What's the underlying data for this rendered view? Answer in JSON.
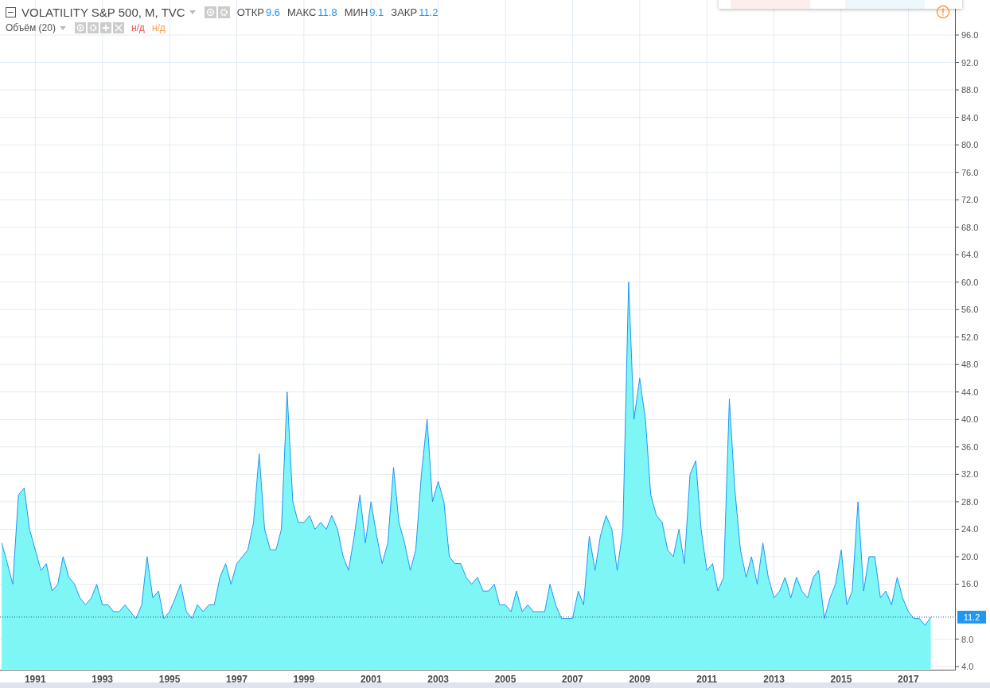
{
  "legend": {
    "title": "VOLATILITY S&P 500, M, TVC",
    "stats": [
      {
        "label": "ОТКР",
        "value": "9.6"
      },
      {
        "label": "МАКС",
        "value": "11.8"
      },
      {
        "label": "МИН",
        "value": "9.1"
      },
      {
        "label": "ЗАКР",
        "value": "11.2"
      }
    ]
  },
  "volume": {
    "title": "Объём (20)",
    "values": [
      {
        "text": "н/д",
        "color": "#f0504f"
      },
      {
        "text": "н/д",
        "color": "#ff9a3c"
      }
    ]
  },
  "chart": {
    "chart_data": {
      "type": "area",
      "grid": true,
      "ref_lines": [
        {
          "axis": "y",
          "value": 11.2,
          "label": "11.2"
        }
      ],
      "series": [
        {
          "color": "#2196f3",
          "values": [
            22,
            19,
            16,
            29,
            30,
            24,
            21,
            18,
            19,
            15,
            16,
            20,
            17,
            16,
            14,
            13,
            14,
            16,
            13,
            13,
            12,
            12,
            13,
            12,
            11,
            13,
            20,
            14,
            15,
            11,
            12,
            14,
            16,
            12,
            11,
            13,
            12,
            13,
            13,
            17,
            19,
            16,
            19,
            20,
            21,
            25,
            35,
            24,
            21,
            21,
            24,
            44,
            28,
            25,
            25,
            26,
            24,
            25,
            24,
            26,
            24,
            20,
            18,
            23,
            29,
            22,
            28,
            23,
            19,
            22,
            33,
            25,
            22,
            18,
            21,
            32,
            40,
            28,
            31,
            28,
            20,
            19,
            19,
            17,
            16,
            17,
            15,
            15,
            16,
            13,
            13,
            12,
            15,
            12,
            13,
            12,
            12,
            12,
            16,
            13,
            11,
            11,
            11,
            15,
            13,
            23,
            18,
            23,
            26,
            24,
            18,
            24,
            60,
            40,
            46,
            40,
            29,
            26,
            25,
            21,
            20,
            24,
            19,
            32,
            34,
            24,
            18,
            19,
            15,
            17,
            43,
            30,
            21,
            17,
            20,
            16,
            22,
            17,
            14,
            15,
            17,
            14,
            17,
            15,
            14,
            17,
            18,
            11,
            14,
            16,
            21,
            13,
            15,
            28,
            15,
            20,
            20,
            14,
            15,
            13,
            17,
            14,
            12,
            11,
            11,
            10,
            11.2
          ]
        }
      ],
      "x": [
        1990,
        1990.17,
        1990.33,
        1990.5,
        1990.67,
        1990.83,
        1991,
        1991.17,
        1991.33,
        1991.5,
        1991.67,
        1991.83,
        1992,
        1992.17,
        1992.33,
        1992.5,
        1992.67,
        1992.83,
        1993,
        1993.17,
        1993.33,
        1993.5,
        1993.67,
        1993.83,
        1994,
        1994.17,
        1994.33,
        1994.5,
        1994.67,
        1994.83,
        1995,
        1995.17,
        1995.33,
        1995.5,
        1995.67,
        1995.83,
        1996,
        1996.17,
        1996.33,
        1996.5,
        1996.67,
        1996.83,
        1997,
        1997.17,
        1997.33,
        1997.5,
        1997.67,
        1997.83,
        1998,
        1998.17,
        1998.33,
        1998.5,
        1998.67,
        1998.83,
        1999,
        1999.17,
        1999.33,
        1999.5,
        1999.67,
        1999.83,
        2000,
        2000.17,
        2000.33,
        2000.5,
        2000.67,
        2000.83,
        2001,
        2001.17,
        2001.33,
        2001.5,
        2001.67,
        2001.83,
        2002,
        2002.17,
        2002.33,
        2002.5,
        2002.67,
        2002.83,
        2003,
        2003.17,
        2003.33,
        2003.5,
        2003.67,
        2003.83,
        2004,
        2004.17,
        2004.33,
        2004.5,
        2004.67,
        2004.83,
        2005,
        2005.17,
        2005.33,
        2005.5,
        2005.67,
        2005.83,
        2006,
        2006.17,
        2006.33,
        2006.5,
        2006.67,
        2006.83,
        2007,
        2007.17,
        2007.33,
        2007.5,
        2007.67,
        2007.83,
        2008,
        2008.17,
        2008.33,
        2008.5,
        2008.67,
        2008.83,
        2009,
        2009.17,
        2009.33,
        2009.5,
        2009.67,
        2009.83,
        2010,
        2010.17,
        2010.33,
        2010.5,
        2010.67,
        2010.83,
        2011,
        2011.17,
        2011.33,
        2011.5,
        2011.67,
        2011.83,
        2012,
        2012.17,
        2012.33,
        2012.5,
        2012.67,
        2012.83,
        2013,
        2013.17,
        2013.33,
        2013.5,
        2013.67,
        2013.83,
        2014,
        2014.17,
        2014.33,
        2014.5,
        2014.67,
        2014.83,
        2015,
        2015.17,
        2015.33,
        2015.5,
        2015.67,
        2015.83,
        2016,
        2016.17,
        2016.33,
        2016.5,
        2016.67,
        2016.83,
        2017,
        2017.17,
        2017.33,
        2017.5,
        2017.67
      ],
      "xlim": [
        1989.95,
        2018.39
      ],
      "ylim": [
        3.54,
        101.1
      ],
      "xticks": [
        {
          "value": 1991,
          "label": "1991"
        },
        {
          "value": 1993,
          "label": "1993"
        },
        {
          "value": 1995,
          "label": "1995"
        },
        {
          "value": 1997,
          "label": "1997"
        },
        {
          "value": 1999,
          "label": "1999"
        },
        {
          "value": 2001,
          "label": "2001"
        },
        {
          "value": 2003,
          "label": "2003"
        },
        {
          "value": 2005,
          "label": "2005"
        },
        {
          "value": 2007,
          "label": "2007"
        },
        {
          "value": 2009,
          "label": "2009"
        },
        {
          "value": 2011,
          "label": "2011"
        },
        {
          "value": 2013,
          "label": "2013"
        },
        {
          "value": 2015,
          "label": "2015"
        },
        {
          "value": 2017,
          "label": "2017"
        }
      ],
      "yticks": [
        {
          "value": 4,
          "label": "4.0"
        },
        {
          "value": 8,
          "label": "8.0"
        },
        {
          "value": 16,
          "label": "16.0"
        },
        {
          "value": 20,
          "label": "20.0"
        },
        {
          "value": 24,
          "label": "24.0"
        },
        {
          "value": 28,
          "label": "28.0"
        },
        {
          "value": 32,
          "label": "32.0"
        },
        {
          "value": 36,
          "label": "36.0"
        },
        {
          "value": 40,
          "label": "40.0"
        },
        {
          "value": 44,
          "label": "44.0"
        },
        {
          "value": 48,
          "label": "48.0"
        },
        {
          "value": 52,
          "label": "52.0"
        },
        {
          "value": 56,
          "label": "56.0"
        },
        {
          "value": 60,
          "label": "60.0"
        },
        {
          "value": 64,
          "label": "64.0"
        },
        {
          "value": 68,
          "label": "68.0"
        },
        {
          "value": 72,
          "label": "72.0"
        },
        {
          "value": 76,
          "label": "76.0"
        },
        {
          "value": 80,
          "label": "80.0"
        },
        {
          "value": 84,
          "label": "84.0"
        },
        {
          "value": 88,
          "label": "88.0"
        },
        {
          "value": 92,
          "label": "92.0"
        },
        {
          "value": 96,
          "label": "96.0"
        }
      ]
    }
  }
}
